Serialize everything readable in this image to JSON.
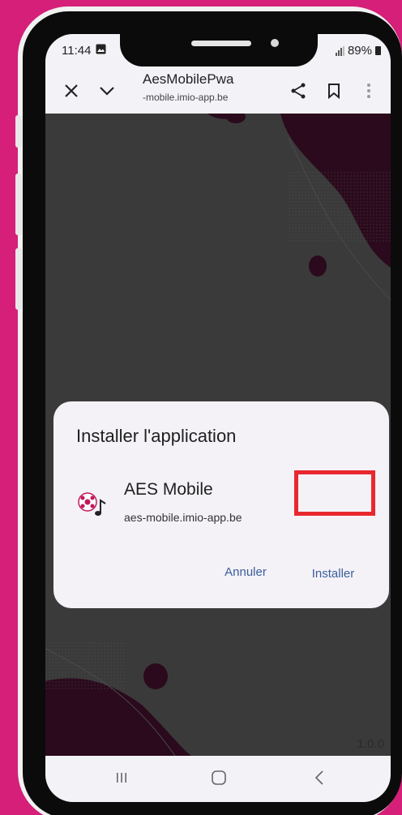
{
  "status_bar": {
    "time": "11:44",
    "battery": "89%"
  },
  "browser": {
    "title": "AesMobilePwa",
    "url": "-mobile.imio-app.be",
    "icons": [
      "close-icon",
      "chevron-down-icon",
      "share-icon",
      "bookmark-icon",
      "more-vert-icon"
    ]
  },
  "dialog": {
    "title": "Installer l'application",
    "app_name": "AES Mobile",
    "app_url": "aes-mobile.imio-app.be",
    "cancel_label": "Annuler",
    "install_label": "Installer"
  },
  "page": {
    "version": "1.0.0"
  },
  "nav_bar": {
    "icons": [
      "recent-apps-icon",
      "home-icon",
      "back-icon"
    ]
  },
  "colors": {
    "background": "#d51f79",
    "accent_text": "#3b5d9c",
    "highlight": "#e8282e",
    "blob": "#2a0a1c"
  }
}
